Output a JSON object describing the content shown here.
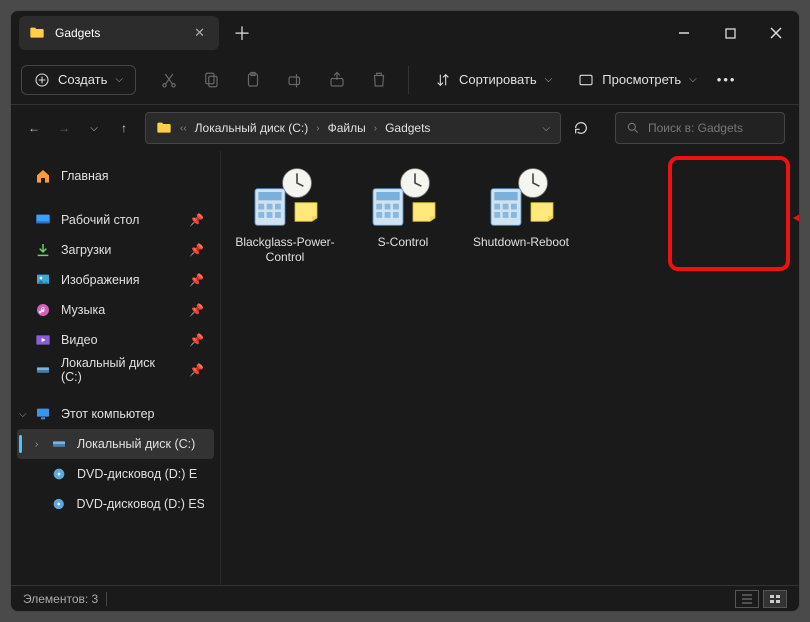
{
  "tab": {
    "title": "Gadgets"
  },
  "toolbar": {
    "new_label": "Создать",
    "sort_label": "Сортировать",
    "view_label": "Просмотреть"
  },
  "breadcrumbs": {
    "c0": "Локальный диск (C:)",
    "c1": "Файлы",
    "c2": "Gadgets"
  },
  "search": {
    "placeholder": "Поиск в: Gadgets"
  },
  "sidebar": {
    "home": "Главная",
    "desktop": "Рабочий стол",
    "downloads": "Загрузки",
    "pictures": "Изображения",
    "music": "Музыка",
    "video": "Видео",
    "disk_c": "Локальный диск (C:)",
    "this_pc": "Этот компьютер",
    "disk_c2": "Локальный диск (C:)",
    "dvd1": "DVD-дисковод (D:) E",
    "dvd2": "DVD-дисковод (D:) ESI"
  },
  "files": {
    "f0": "Blackglass-Power-Control",
    "f1": "S-Control",
    "f2": "Shutdown-Reboot"
  },
  "status": {
    "count_label": "Элементов: 3"
  }
}
